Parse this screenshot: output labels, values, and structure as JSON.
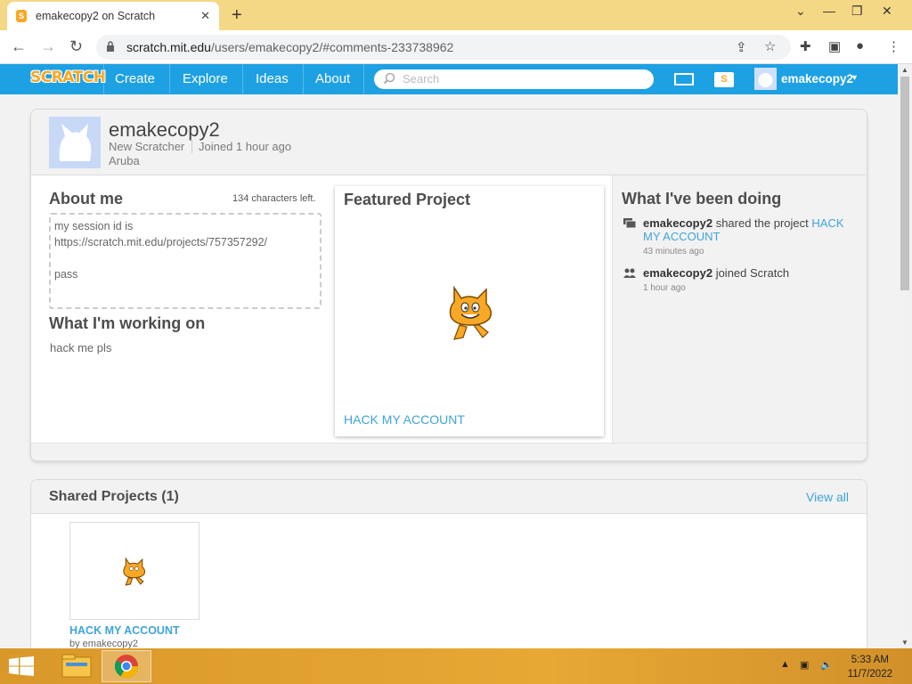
{
  "browser": {
    "tab_title": "emakecopy2 on Scratch",
    "url_host": "scratch.mit.edu",
    "url_path": "/users/emakecopy2/#comments-233738962"
  },
  "nav": {
    "logo": "SCRATCH",
    "links": [
      "Create",
      "Explore",
      "Ideas",
      "About"
    ],
    "search_placeholder": "Search",
    "username": "emakecopy2"
  },
  "profile": {
    "username": "emakecopy2",
    "status": "New Scratcher",
    "joined": "Joined 1 hour ago",
    "location": "Aruba"
  },
  "about": {
    "heading": "About me",
    "chars_left": "134 characters left.",
    "line1": "my session id is",
    "line2": "https://scratch.mit.edu/projects/757357292/",
    "line3": "pass"
  },
  "working_on": {
    "heading": "What I'm working on",
    "text": "hack me pls"
  },
  "featured": {
    "heading": "Featured Project",
    "project_title": "HACK MY ACCOUNT"
  },
  "activity": {
    "heading": "What I've been doing",
    "items": [
      {
        "user": "emakecopy2",
        "action": "shared the project",
        "link": "HACK MY ACCOUNT",
        "time": "43 minutes ago"
      },
      {
        "user": "emakecopy2",
        "action": "joined Scratch",
        "link": "",
        "time": "1 hour ago"
      }
    ]
  },
  "shared": {
    "heading": "Shared Projects (1)",
    "view_all": "View all",
    "project_title": "HACK MY ACCOUNT",
    "project_by": "by emakecopy2"
  },
  "taskbar": {
    "time": "5:33 AM",
    "date": "11/7/2022"
  },
  "colors": {
    "scratch_blue": "#1ea1e3",
    "link_blue": "#3fa4d9",
    "tabstrip": "#f5d886"
  }
}
